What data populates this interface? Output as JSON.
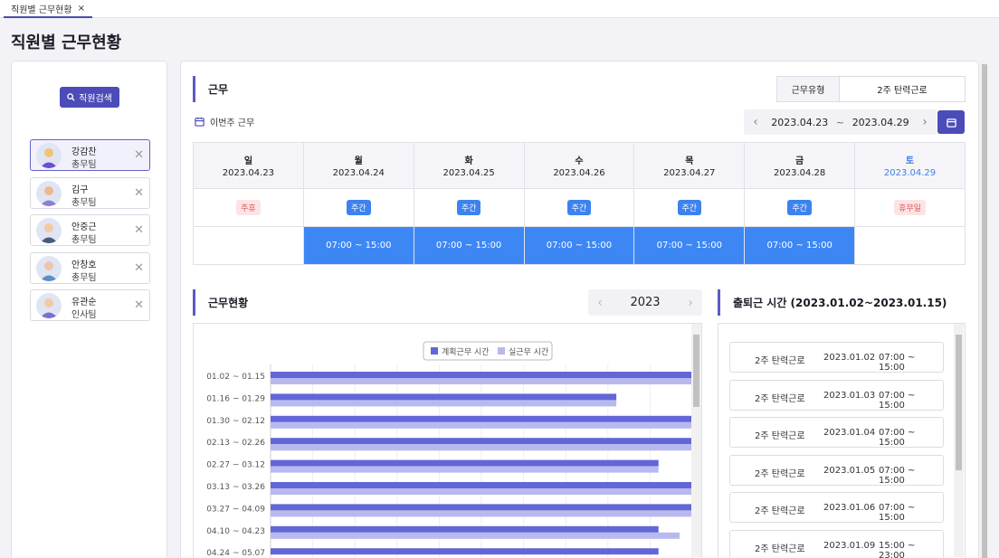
{
  "tab": {
    "label": "직원별 근무현황",
    "close": "×"
  },
  "page_title": "직원별 근무현황",
  "search_button": "직원검색",
  "employees": [
    {
      "name": "강감찬",
      "team": "총무팀",
      "selected": true
    },
    {
      "name": "김구",
      "team": "총무팀",
      "selected": false
    },
    {
      "name": "안중근",
      "team": "총무팀",
      "selected": false
    },
    {
      "name": "안창호",
      "team": "총무팀",
      "selected": false
    },
    {
      "name": "유관순",
      "team": "인사팀",
      "selected": false
    }
  ],
  "work": {
    "title": "근무",
    "type_label": "근무유형",
    "type_value": "2주 탄력근로",
    "week_label": "이번주 근무",
    "range_start": "2023.04.23",
    "range_sep": "~",
    "range_end": "2023.04.29",
    "days": [
      {
        "day": "일",
        "date": "2023.04.23",
        "tag": "주휴",
        "tag_style": "red",
        "time": ""
      },
      {
        "day": "월",
        "date": "2023.04.24",
        "tag": "주간",
        "tag_style": "blue",
        "time": "07:00 ~ 15:00"
      },
      {
        "day": "화",
        "date": "2023.04.25",
        "tag": "주간",
        "tag_style": "blue",
        "time": "07:00 ~ 15:00"
      },
      {
        "day": "수",
        "date": "2023.04.26",
        "tag": "주간",
        "tag_style": "blue",
        "time": "07:00 ~ 15:00"
      },
      {
        "day": "목",
        "date": "2023.04.27",
        "tag": "주간",
        "tag_style": "blue",
        "time": "07:00 ~ 15:00"
      },
      {
        "day": "금",
        "date": "2023.04.28",
        "tag": "주간",
        "tag_style": "blue",
        "time": "07:00 ~ 15:00"
      },
      {
        "day": "토",
        "date": "2023.04.29",
        "tag": "휴무일",
        "tag_style": "red",
        "time": ""
      }
    ]
  },
  "status": {
    "title": "근무현황",
    "year": "2023"
  },
  "chart_data": {
    "type": "bar",
    "orientation": "horizontal",
    "categories": [
      "01.02 ~ 01.15",
      "01.16 ~ 01.29",
      "01.30 ~ 02.12",
      "02.13 ~ 02.26",
      "02.27 ~ 03.12",
      "03.13 ~ 03.26",
      "03.27 ~ 04.09",
      "04.10 ~ 04.23",
      "04.24 ~ 05.07"
    ],
    "series": [
      {
        "name": "계획근무 시간",
        "color": "#6366d6",
        "values": [
          100,
          82,
          100,
          100,
          92,
          100,
          100,
          92,
          92
        ]
      },
      {
        "name": "실근무 시간",
        "color": "#b8b9ee",
        "values": [
          100,
          82,
          100,
          100,
          92,
          100,
          100,
          97,
          0
        ]
      }
    ],
    "xlim": [
      0,
      100
    ],
    "grid": true,
    "legend": "top-center"
  },
  "commute": {
    "title": "출퇴근 시간 (2023.01.02~2023.01.15)",
    "rows": [
      {
        "type": "2주 탄력근로",
        "date": "2023.01.02",
        "time": "07:00 ~ 15:00"
      },
      {
        "type": "2주 탄력근로",
        "date": "2023.01.03",
        "time": "07:00 ~ 15:00"
      },
      {
        "type": "2주 탄력근로",
        "date": "2023.01.04",
        "time": "07:00 ~ 15:00"
      },
      {
        "type": "2주 탄력근로",
        "date": "2023.01.05",
        "time": "07:00 ~ 15:00"
      },
      {
        "type": "2주 탄력근로",
        "date": "2023.01.06",
        "time": "07:00 ~ 15:00"
      },
      {
        "type": "2주 탄력근로",
        "date": "2023.01.09",
        "time": "15:00 ~ 23:00"
      }
    ]
  }
}
